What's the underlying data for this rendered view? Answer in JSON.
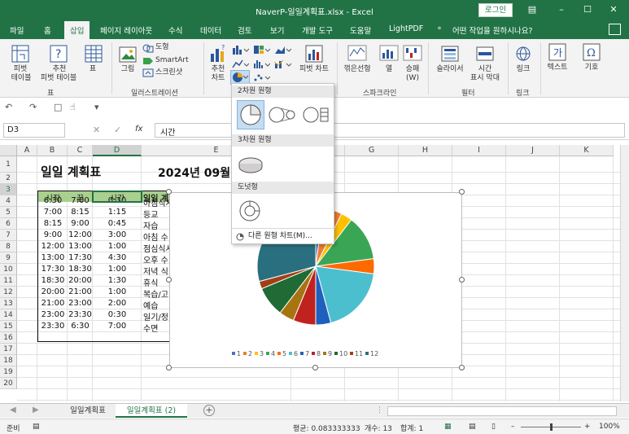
{
  "window": {
    "title": "NaverP-일일계획표.xlsx  -  Excel",
    "login_label": "로그인"
  },
  "menu": {
    "tabs": [
      "파일",
      "홈",
      "삽입",
      "페이지 레이아웃",
      "수식",
      "데이터",
      "검토",
      "보기",
      "개발 도구",
      "도움말",
      "LightPDF"
    ],
    "active_tab": "삽입",
    "search_placeholder": "어떤 작업을 원하시나요?"
  },
  "ribbon": {
    "pivot_label_1": "피벗",
    "pivot_label_2": "테이블",
    "rec_pivot_label_1": "추천",
    "rec_pivot_label_2": "피벗 테이블",
    "table_label": "표",
    "table_group": "표",
    "picture_label": "그림",
    "shapes_label": "도형",
    "smartart_label": "SmartArt",
    "screenshot_label": "스크린샷",
    "illustration_group": "일러스트레이션",
    "rec_chart_label_1": "추천",
    "rec_chart_label_2": "차트",
    "pivot_chart_label": "피벗 차트",
    "line_spark_label": "꺾은선형",
    "column_spark_label": "열",
    "winloss_label_1": "승패",
    "winloss_label_2": "(W)",
    "sparkline_group": "스파크라인",
    "slicer_label": "슬라이서",
    "timeline_label_1": "시간",
    "timeline_label_2": "표시 막대",
    "filter_group": "필터",
    "link_label": "링크",
    "link_group": "링크",
    "text_label": "텍스트",
    "symbol_label": "기호"
  },
  "formula_bar": {
    "name_box": "D3",
    "fx": "fx",
    "content": "시간"
  },
  "columns": [
    "A",
    "B",
    "C",
    "D",
    "E",
    "F",
    "G",
    "H",
    "I",
    "J",
    "K"
  ],
  "rows": [
    "1",
    "2",
    "3",
    "4",
    "5",
    "6",
    "7",
    "8",
    "9",
    "10",
    "11",
    "12",
    "13",
    "14",
    "15",
    "16",
    "17",
    "18",
    "19",
    "20"
  ],
  "sheet": {
    "title": "일일 계획표",
    "date": "2024년 09월",
    "headers": [
      "시작",
      "끝",
      "시간",
      "일일 계"
    ],
    "data": [
      [
        "6:30",
        "7:00",
        "0:30",
        "아침식사"
      ],
      [
        "7:00",
        "8:15",
        "1:15",
        "등교"
      ],
      [
        "8:15",
        "9:00",
        "0:45",
        "자습"
      ],
      [
        "9:00",
        "12:00",
        "3:00",
        "아침 수"
      ],
      [
        "12:00",
        "13:00",
        "1:00",
        "점심식사"
      ],
      [
        "13:00",
        "17:30",
        "4:30",
        "오후 수"
      ],
      [
        "17:30",
        "18:30",
        "1:00",
        "저녁 식"
      ],
      [
        "18:30",
        "20:00",
        "1:30",
        "휴식"
      ],
      [
        "20:00",
        "21:00",
        "1:00",
        "복습/고"
      ],
      [
        "21:00",
        "23:00",
        "2:00",
        "예습"
      ],
      [
        "23:00",
        "23:30",
        "0:30",
        "일기/정"
      ],
      [
        "23:30",
        "6:30",
        "7:00",
        "수면"
      ]
    ]
  },
  "chart_data": {
    "type": "pie",
    "categories": [
      "1",
      "2",
      "3",
      "4",
      "5",
      "6",
      "7",
      "8",
      "9",
      "10",
      "11",
      "12"
    ],
    "values": [
      0.5,
      1.25,
      0.75,
      3,
      1,
      4.5,
      1,
      1.5,
      1,
      2,
      0.5,
      7
    ],
    "colors": [
      "#4472c4",
      "#ed7d31",
      "#ffc000",
      "#3aa655",
      "#ff6a00",
      "#4cbfcf",
      "#1f5fbd",
      "#c0221f",
      "#a8740f",
      "#1f6a35",
      "#a04014",
      "#2a6f7f"
    ],
    "legend_position": "bottom"
  },
  "pie_menu": {
    "section_2d": "2차원 원형",
    "section_3d": "3차원 원형",
    "section_donut": "도넛형",
    "more_label": "다른 원형 차트(M)..."
  },
  "sheet_tabs": [
    "일일계획표",
    "일일계획표 (2)"
  ],
  "active_sheet": "일일계획표 (2)",
  "status": {
    "ready": "준비",
    "average": "평균: 0.083333333",
    "count": "개수: 13",
    "sum": "합계: 1",
    "zoom": "100%"
  }
}
